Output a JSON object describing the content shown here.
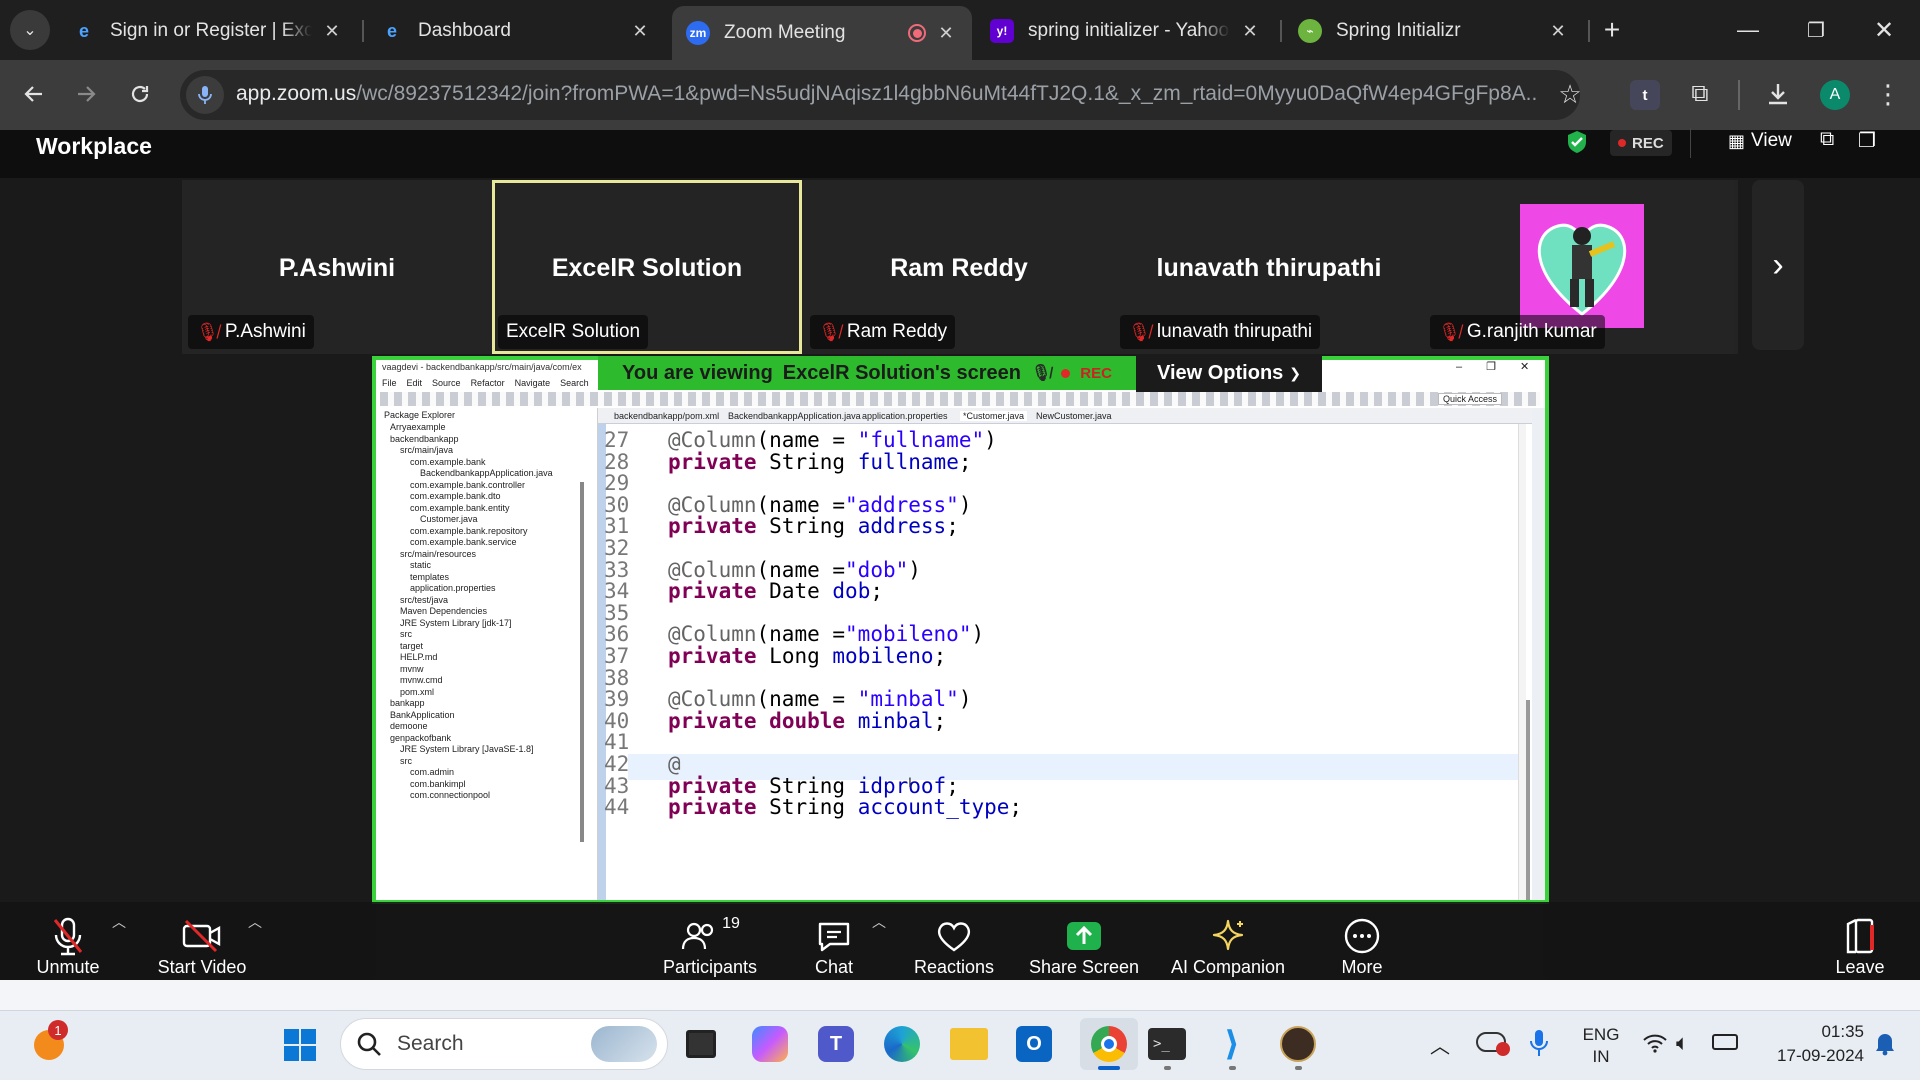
{
  "browser": {
    "tabs": [
      {
        "title": "Sign in or Register | Excel",
        "icon": "excelr-icon"
      },
      {
        "title": "Dashboard",
        "icon": "excelr-icon"
      },
      {
        "title": "Zoom Meeting",
        "icon": "zoom-icon",
        "active": true
      },
      {
        "title": "spring initializer - Yahoo",
        "icon": "yahoo-icon"
      },
      {
        "title": "Spring Initializr",
        "icon": "spring-icon"
      }
    ],
    "url_host": "app.zoom.us",
    "url_rest": "/wc/89237512342/join?fromPWA=1&pwd=Ns5udjNAqisz1l4gbbN6uMt44fTJ2Q.1&_x_zm_rtaid=0Myyu0DaQfW4ep4GFgFp8A....",
    "profile_initial": "A",
    "ext_initial": "t"
  },
  "zoom": {
    "workplace": "Workplace",
    "rec": "REC",
    "view": "View",
    "participants": [
      {
        "name": "P.Ashwini",
        "label": "P.Ashwini",
        "muted": true
      },
      {
        "name": "ExcelR Solution",
        "label": "ExcelR Solution",
        "muted": false
      },
      {
        "name": "Ram Reddy",
        "label": "Ram Reddy",
        "muted": true
      },
      {
        "name": "lunavath thirupathi",
        "label": "lunavath thirupathi",
        "muted": true
      },
      {
        "name": "",
        "label": "G.ranjith kumar",
        "muted": true
      }
    ],
    "viewing_banner": "You are viewing",
    "viewing_who": "ExcelR Solution's screen",
    "banner_rec": "REC",
    "view_options": "View Options",
    "controls": {
      "unmute": "Unmute",
      "start_video": "Start Video",
      "participants": "Participants",
      "participants_count": "19",
      "chat": "Chat",
      "reactions": "Reactions",
      "share_screen": "Share Screen",
      "ai_companion": "AI Companion",
      "more": "More",
      "leave": "Leave"
    }
  },
  "eclipse": {
    "title": "vaagdevi - backendbankapp/src/main/java/com/ex",
    "menu": [
      "File",
      "Edit",
      "Source",
      "Refactor",
      "Navigate",
      "Search"
    ],
    "quick_access": "Quick Access",
    "panel_title": "Package Explorer",
    "editor_tabs": [
      "backendbankapp/pom.xml",
      "BackendbankappApplication.java",
      "application.properties",
      "*Customer.java",
      "NewCustomer.java"
    ],
    "tree": [
      "Arryaexample",
      "backendbankapp",
      "src/main/java",
      "com.example.bank",
      "BackendbankappApplication.java",
      "com.example.bank.controller",
      "com.example.bank.dto",
      "com.example.bank.entity",
      "Customer.java",
      "com.example.bank.repository",
      "com.example.bank.service",
      "src/main/resources",
      "static",
      "templates",
      "application.properties",
      "src/test/java",
      "Maven Dependencies",
      "JRE System Library [jdk-17]",
      "src",
      "target",
      "HELP.md",
      "mvnw",
      "mvnw.cmd",
      "pom.xml",
      "bankapp",
      "BankApplication",
      "demoone",
      "genpackofbank",
      "JRE System Library [JavaSE-1.8]",
      "src",
      "com.admin",
      "com.bankimpl",
      "com.connectionpool"
    ],
    "lines": [
      {
        "n": "27",
        "ann": "@Column",
        "args": "(name = ",
        "str": "\"fullname\"",
        "end": ")"
      },
      {
        "n": "28",
        "mod": "private",
        "type": "String",
        "field": "fullname"
      },
      {
        "n": "29"
      },
      {
        "n": "30",
        "ann": "@Column",
        "args": "(name =",
        "str": "\"address\"",
        "end": ")"
      },
      {
        "n": "31",
        "mod": "private",
        "type": "String",
        "field": "address"
      },
      {
        "n": "32"
      },
      {
        "n": "33",
        "ann": "@Column",
        "args": "(name =",
        "str": "\"dob\"",
        "end": ")"
      },
      {
        "n": "34",
        "mod": "private",
        "type": "Date",
        "field": "dob"
      },
      {
        "n": "35"
      },
      {
        "n": "36",
        "ann": "@Column",
        "args": "(name =",
        "str": "\"mobileno\"",
        "end": ")"
      },
      {
        "n": "37",
        "mod": "private",
        "type": "Long",
        "field": "mobileno"
      },
      {
        "n": "38"
      },
      {
        "n": "39",
        "ann": "@Column",
        "args": "(name = ",
        "str": "\"minbal\"",
        "end": ")"
      },
      {
        "n": "40",
        "mod": "private",
        "type": "double",
        "field": "minbal"
      },
      {
        "n": "41"
      },
      {
        "n": "42",
        "ann": "@"
      },
      {
        "n": "43",
        "mod": "private",
        "type": "String",
        "field": "idproof"
      },
      {
        "n": "44",
        "mod": "private",
        "type": "String",
        "field": "account_type"
      }
    ]
  },
  "taskbar": {
    "search": "Search",
    "lang": "ENG",
    "region": "IN",
    "time": "01:35",
    "date": "17-09-2024",
    "badge": "1"
  }
}
